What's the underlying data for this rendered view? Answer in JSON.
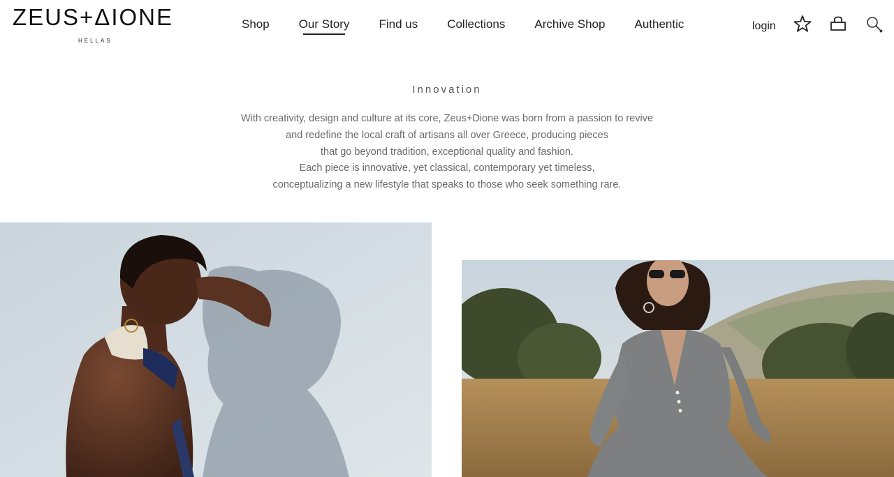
{
  "brand": {
    "name": "ZEUS+ΔIONE",
    "tagline": "HELLAS"
  },
  "nav": {
    "items": [
      {
        "label": "Shop",
        "active": false
      },
      {
        "label": "Our Story",
        "active": true
      },
      {
        "label": "Find us",
        "active": false
      },
      {
        "label": "Collections",
        "active": false
      },
      {
        "label": "Archive Shop",
        "active": false
      },
      {
        "label": "Authentic",
        "active": false
      }
    ]
  },
  "account": {
    "login_label": "login"
  },
  "icons": {
    "wishlist": "star-icon",
    "cart": "basket-icon",
    "search": "search-icon"
  },
  "intro": {
    "title": "Innovation",
    "lines": [
      "With creativity, design and culture at its core, Zeus+Dione was born from a passion to revive",
      "and redefine the local craft of artisans all over Greece, producing pieces",
      "that go beyond tradition, exceptional quality and fashion.",
      "Each piece is innovative, yet classical, contemporary yet timeless,",
      "conceptualizing a new lifestyle that speaks to those who seek something rare."
    ]
  },
  "colors": {
    "text": "#222222",
    "body_text": "#6a6a6a",
    "background": "#ffffff"
  }
}
